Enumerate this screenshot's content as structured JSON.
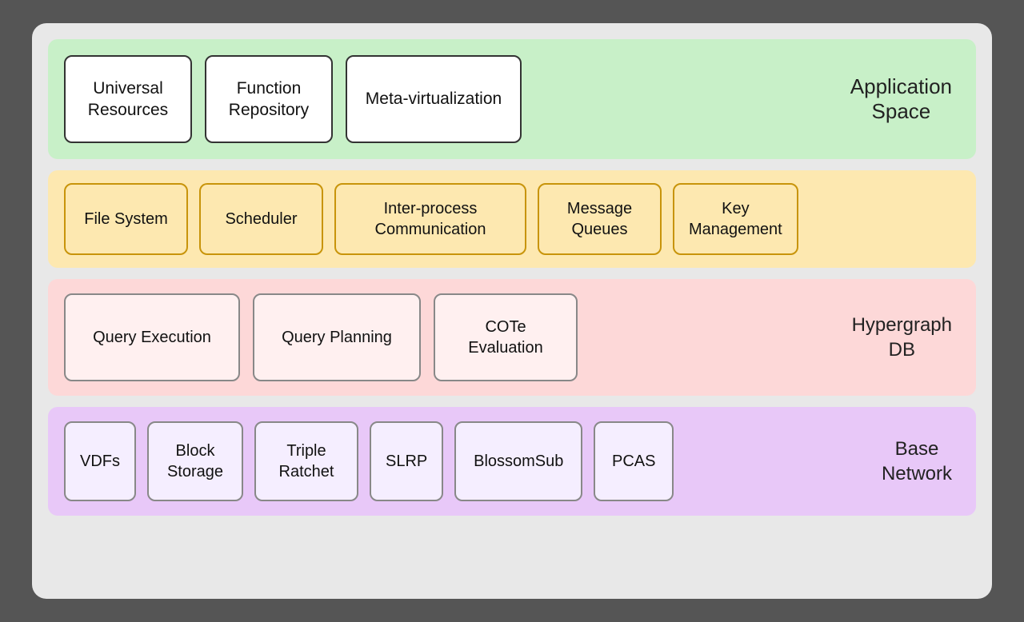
{
  "appSpace": {
    "label": "Application\nSpace",
    "boxes": [
      {
        "id": "universal-resources",
        "text": "Universal\nResources"
      },
      {
        "id": "function-repository",
        "text": "Function\nRepository"
      },
      {
        "id": "meta-virtualization",
        "text": "Meta-virtualization"
      }
    ]
  },
  "osLayer": {
    "boxes": [
      {
        "id": "file-system",
        "text": "File System"
      },
      {
        "id": "scheduler",
        "text": "Scheduler"
      },
      {
        "id": "ipc",
        "text": "Inter-process\nCommunication"
      },
      {
        "id": "message-queues",
        "text": "Message\nQueues"
      },
      {
        "id": "key-management",
        "text": "Key\nManagement"
      }
    ]
  },
  "dbLayer": {
    "label": "Hypergraph\nDB",
    "boxes": [
      {
        "id": "query-execution",
        "text": "Query Execution"
      },
      {
        "id": "query-planning",
        "text": "Query Planning"
      },
      {
        "id": "cote-evaluation",
        "text": "COTe\nEvaluation"
      }
    ]
  },
  "baseNetwork": {
    "label": "Base\nNetwork",
    "boxes": [
      {
        "id": "vdfs",
        "text": "VDFs"
      },
      {
        "id": "block-storage",
        "text": "Block\nStorage"
      },
      {
        "id": "triple-ratchet",
        "text": "Triple\nRatchet"
      },
      {
        "id": "slrp",
        "text": "SLRP"
      },
      {
        "id": "blossomsub",
        "text": "BlossomSub"
      },
      {
        "id": "pcas",
        "text": "PCAS"
      }
    ]
  }
}
